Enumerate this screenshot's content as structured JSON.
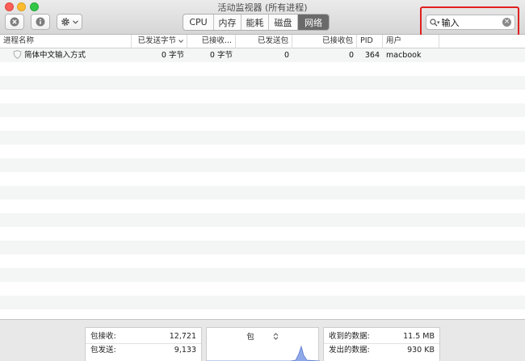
{
  "window": {
    "title": "活动监视器 (所有进程)"
  },
  "tabs": [
    {
      "label": "CPU",
      "active": false
    },
    {
      "label": "内存",
      "active": false
    },
    {
      "label": "能耗",
      "active": false
    },
    {
      "label": "磁盘",
      "active": false
    },
    {
      "label": "网络",
      "active": true
    }
  ],
  "search": {
    "value": "输入",
    "clear_glyph": "×"
  },
  "columns": [
    "进程名称",
    "已发送字节",
    "已接收...",
    "已发送包",
    "已接收包",
    "PID",
    "用户"
  ],
  "rows": [
    {
      "name": "简体中文输入方式",
      "sent_bytes": "0 字节",
      "recv_bytes": "0 字节",
      "sent_packets": "0",
      "recv_packets": "0",
      "pid": "364",
      "user": "macbook"
    }
  ],
  "footer": {
    "packets": {
      "received_label": "包接收:",
      "received_value": "12,721",
      "sent_label": "包发送:",
      "sent_value": "9,133"
    },
    "chart_selector": "包",
    "data": {
      "received_label": "收到的数据:",
      "received_value": "11.5 MB",
      "sent_label": "发出的数据:",
      "sent_value": "930 KB"
    }
  },
  "icons": {
    "stop": "stop-process-icon",
    "info": "info-icon",
    "gear": "gear-icon",
    "search": "magnifier-icon"
  }
}
